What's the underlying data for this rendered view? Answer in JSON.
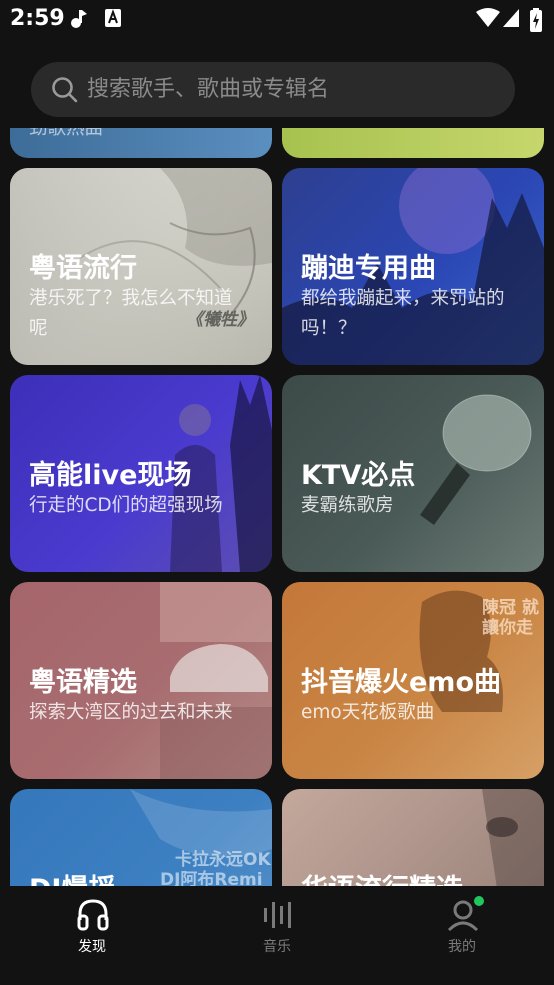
{
  "status_bar": {
    "time": "2:59"
  },
  "search": {
    "placeholder": "搜索歌手、歌曲或专辑名"
  },
  "top_partial_text": "劲歌热曲",
  "cards": [
    {
      "title": "粤语流行",
      "subtitle": "港乐死了？我怎么不知道呢",
      "deco_text": "《犧牲》"
    },
    {
      "title": "蹦迪专用曲",
      "subtitle": "都给我蹦起来，来罚站的吗！？"
    },
    {
      "title": "高能live现场",
      "subtitle": "行走的CD们的超强现场"
    },
    {
      "title": "KTV必点",
      "subtitle": "麦霸练歌房"
    },
    {
      "title": "粤语精选",
      "subtitle": "探索大湾区的过去和未来"
    },
    {
      "title": "抖音爆火emo曲",
      "subtitle": "emo天花板歌曲",
      "deco_text": "陳冠 就讓你走"
    },
    {
      "title": "DJ慢摇",
      "deco_text_1": "卡拉永远OK",
      "deco_text_2": "DJ阿布Remi"
    },
    {
      "title": "华语流行精选"
    }
  ],
  "nav": {
    "items": [
      {
        "label": "发现"
      },
      {
        "label": "音乐"
      },
      {
        "label": "我的"
      }
    ],
    "active_color": "#ffffff",
    "inactive_color": "#7a7a7a"
  }
}
